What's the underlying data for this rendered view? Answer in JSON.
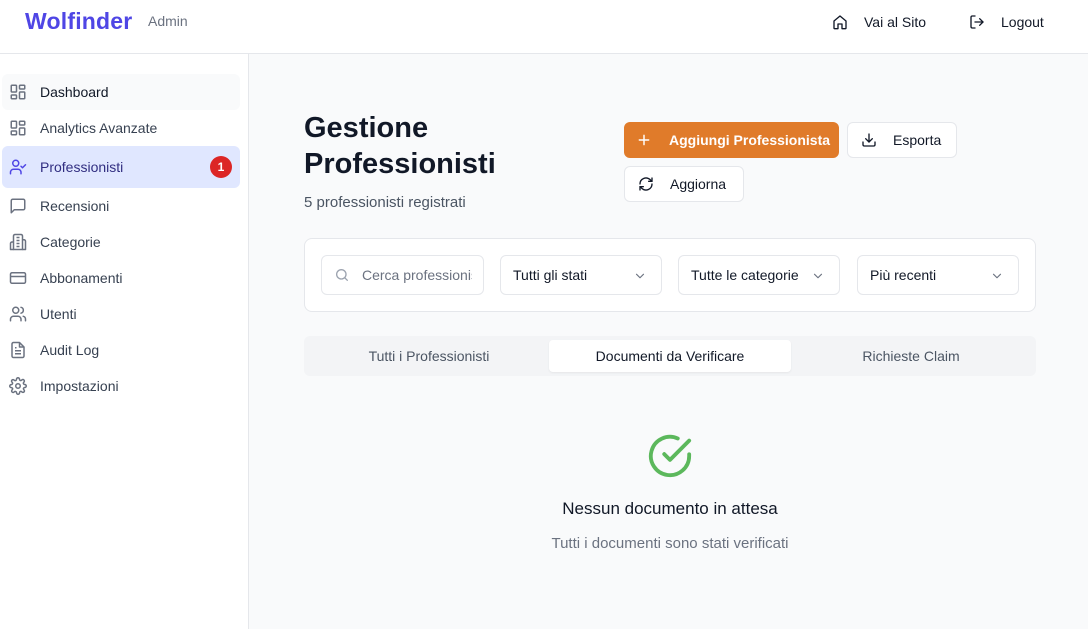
{
  "header": {
    "brand": "Wolfinder",
    "brand_sub": "Admin",
    "site_link": "Vai al Sito",
    "logout": "Logout"
  },
  "sidebar": {
    "items": [
      {
        "label": "Dashboard",
        "icon": "layout-grid-icon"
      },
      {
        "label": "Analytics Avanzate",
        "icon": "layout-grid-icon"
      },
      {
        "label": "Professionisti",
        "icon": "user-check-icon",
        "badge": "1"
      },
      {
        "label": "Recensioni",
        "icon": "message-square-icon"
      },
      {
        "label": "Categorie",
        "icon": "building-icon"
      },
      {
        "label": "Abbonamenti",
        "icon": "credit-card-icon"
      },
      {
        "label": "Utenti",
        "icon": "users-icon"
      },
      {
        "label": "Audit Log",
        "icon": "file-text-icon"
      },
      {
        "label": "Impostazioni",
        "icon": "gear-icon"
      }
    ]
  },
  "main": {
    "title": "Gestione Professionisti",
    "subtitle": "5 professionisti registrati",
    "buttons": {
      "add": "Aggiungi Professionista",
      "export": "Esporta",
      "refresh": "Aggiorna"
    },
    "filters": {
      "search_placeholder": "Cerca professionisti...",
      "status": "Tutti gli stati",
      "category": "Tutte le categorie",
      "sort": "Più recenti"
    },
    "tabs": [
      {
        "label": "Tutti i Professionisti"
      },
      {
        "label": "Documenti da Verificare"
      },
      {
        "label": "Richieste Claim"
      }
    ],
    "empty": {
      "title": "Nessun documento in attesa",
      "subtitle": "Tutti i documenti sono stati verificati"
    }
  },
  "colors": {
    "brand": "#4f46e5",
    "primary_button": "#e07b2a",
    "badge": "#dc2626",
    "success": "#5cb85c"
  }
}
